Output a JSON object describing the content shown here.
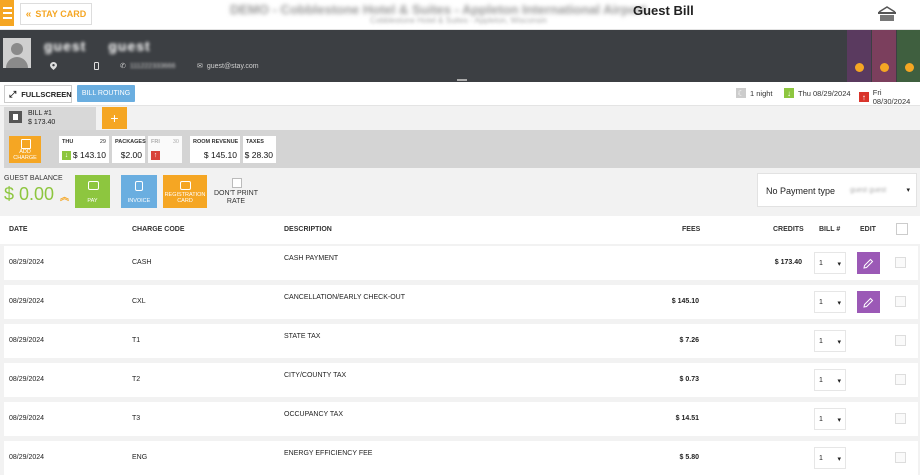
{
  "topbar": {
    "stay_card_label": "STAY CARD",
    "hotel_title": "DEMO - Cobblestone Hotel & Suites - Appleton International Airport",
    "hotel_subtitle": "Cobblestone Hotel & Suites - Appleton, Wisconsin",
    "page_title": "Guest Bill"
  },
  "guest": {
    "first_name": "guest",
    "last_name": "guest",
    "phone": "111222333666",
    "email": "guest@stay.com",
    "tab_colors": [
      "#5a3a5f",
      "#7b3f5d",
      "#3f5f3f"
    ]
  },
  "actions": {
    "fullscreen_label": "FULLSCREEN",
    "bill_routing_label": "BILL ROUTING",
    "nights": "1 night",
    "arrival": "Thu 08/29/2024",
    "departure": "Fri 08/30/2024"
  },
  "bill_tab": {
    "name": "BILL #1",
    "amount": "$ 173.40",
    "add_symbol": "+"
  },
  "summary": {
    "add_charge_label": "ADD CHARGE",
    "day1": {
      "label": "THU",
      "num": "29",
      "value": "$ 143.10"
    },
    "packages": {
      "label": "PACKAGES",
      "value": "$2.00"
    },
    "day2": {
      "label": "FRI",
      "num": "30"
    },
    "room_revenue": {
      "label": "ROOM REVENUE",
      "value": "$ 145.10"
    },
    "taxes": {
      "label": "TAXES",
      "value": "$ 28.30"
    }
  },
  "balance": {
    "label": "GUEST BALANCE",
    "amount": "$ 0.00",
    "pay_label": "PAY",
    "invoice_label": "INVOICE",
    "registration_label": "REGISTRATION CARD",
    "dont_print_label": "DON'T PRINT RATE",
    "payment_type": "No Payment type",
    "payment_guest": "guest guest"
  },
  "table": {
    "headers": {
      "date": "DATE",
      "charge_code": "CHARGE CODE",
      "description": "DESCRIPTION",
      "fees": "FEES",
      "credits": "CREDITS",
      "bill": "BILL #",
      "edit": "EDIT"
    },
    "rows": [
      {
        "date": "08/29/2024",
        "code": "CASH",
        "description": "CASH PAYMENT",
        "fees": "",
        "credits": "$ 173.40",
        "bill": "1",
        "editable": true
      },
      {
        "date": "08/29/2024",
        "code": "CXL",
        "description": "CANCELLATION/EARLY CHECK-OUT",
        "fees": "$ 145.10",
        "credits": "",
        "bill": "1",
        "editable": true
      },
      {
        "date": "08/29/2024",
        "code": "T1",
        "description": "STATE TAX",
        "fees": "$ 7.26",
        "credits": "",
        "bill": "1",
        "editable": false
      },
      {
        "date": "08/29/2024",
        "code": "T2",
        "description": "CITY/COUNTY TAX",
        "fees": "$ 0.73",
        "credits": "",
        "bill": "1",
        "editable": false
      },
      {
        "date": "08/29/2024",
        "code": "T3",
        "description": "OCCUPANCY TAX",
        "fees": "$ 14.51",
        "credits": "",
        "bill": "1",
        "editable": false
      },
      {
        "date": "08/29/2024",
        "code": "ENG",
        "description": "ENERGY EFFICIENCY FEE",
        "fees": "$ 5.80",
        "credits": "",
        "bill": "1",
        "editable": false
      }
    ]
  },
  "colors": {
    "accent": "#f5a623",
    "green": "#8dc63f",
    "blue": "#6aaee0",
    "purple": "#9b59b6",
    "header_dark": "#3c3f43"
  }
}
